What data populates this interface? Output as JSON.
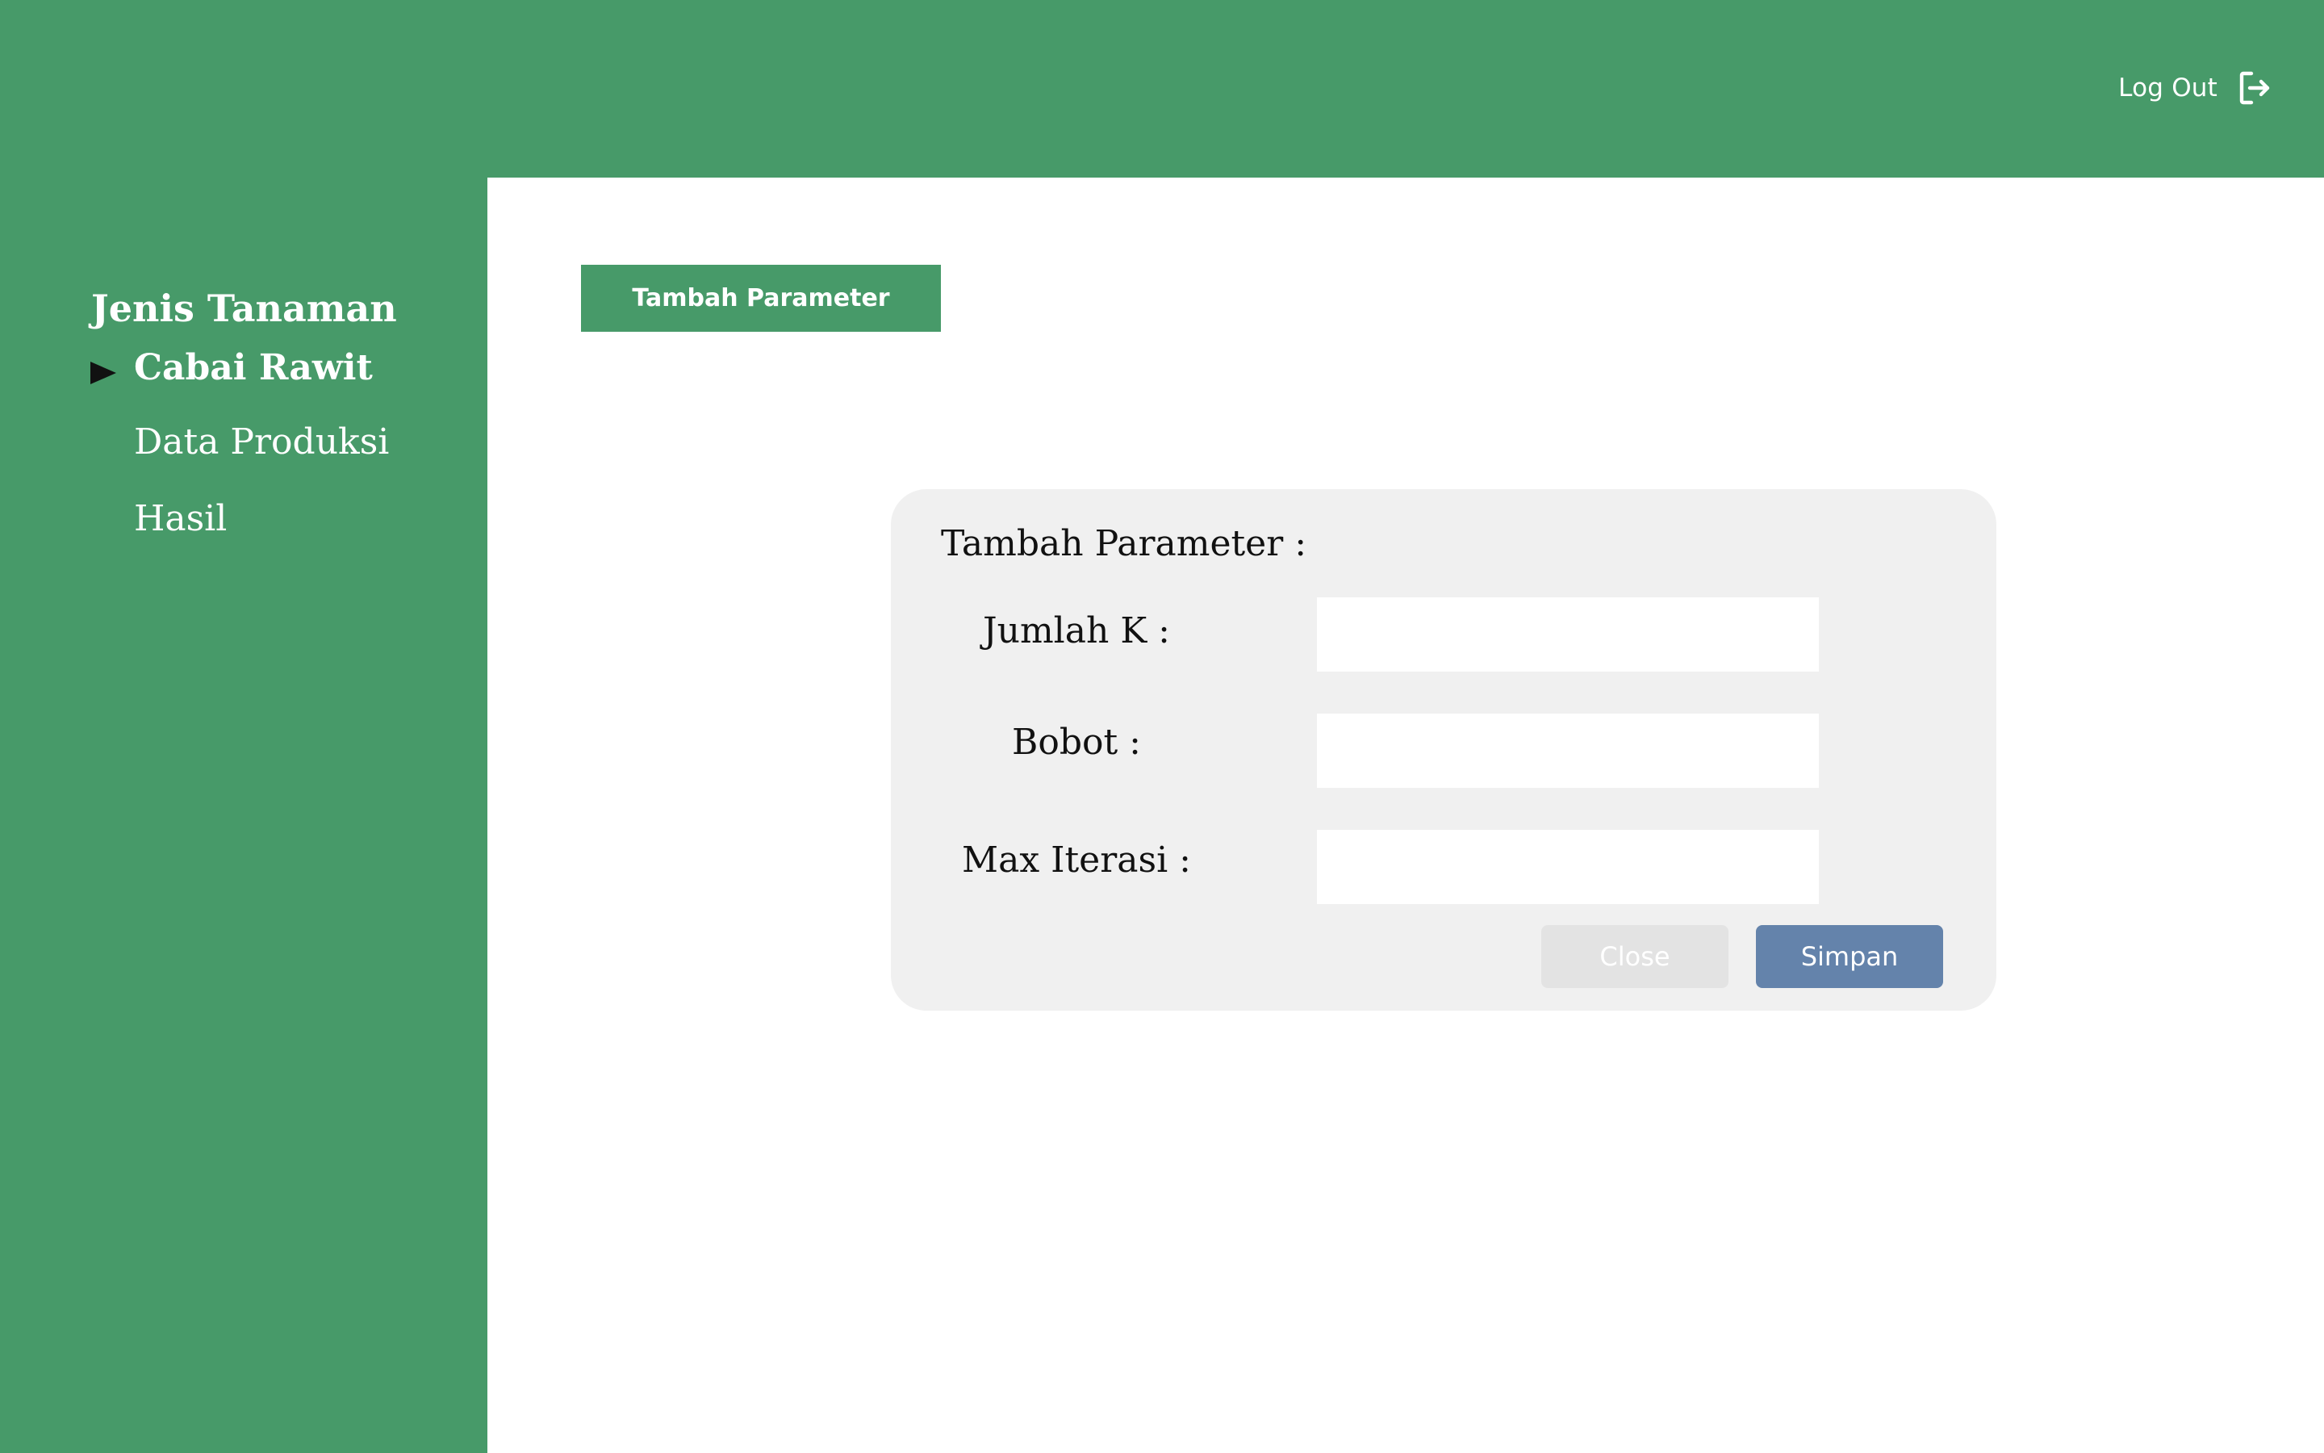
{
  "header": {
    "logout_label": "Log Out",
    "logout_icon": "logout-icon"
  },
  "sidebar": {
    "heading": "Jenis Tanaman",
    "items": [
      {
        "label": "Cabai Rawit",
        "active": true
      },
      {
        "label": "Data Produksi",
        "active": false
      },
      {
        "label": "Hasil",
        "active": false
      }
    ]
  },
  "main": {
    "add_button_label": "Tambah Parameter"
  },
  "modal": {
    "title": "Tambah Parameter :",
    "fields": [
      {
        "label": "Jumlah K :",
        "value": ""
      },
      {
        "label": "Bobot :",
        "value": ""
      },
      {
        "label": "Max Iterasi :",
        "value": ""
      }
    ],
    "close_label": "Close",
    "save_label": "Simpan"
  },
  "colors": {
    "brand_green": "#479a69",
    "save_button": "#6483ab",
    "close_button": "#e3e3e3",
    "modal_background": "#f0f0f0"
  }
}
